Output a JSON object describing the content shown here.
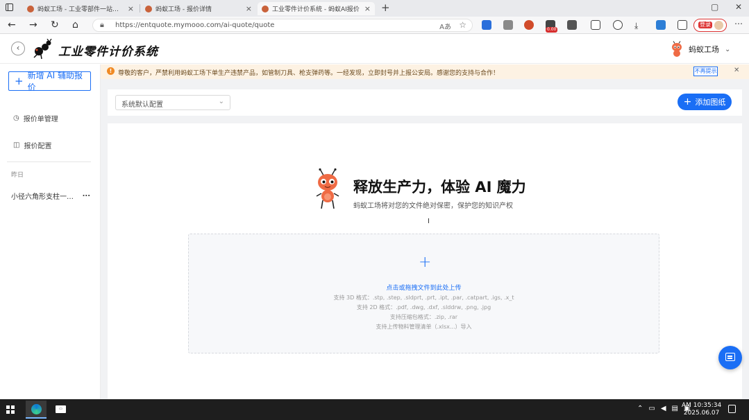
{
  "browser": {
    "tabs": [
      {
        "title": "蚂蚁工场 - 工业零部件一站式采购"
      },
      {
        "title": "蚂蚁工场 - 报价详情"
      },
      {
        "title": "工业零件计价系统 - 蚂蚁AI报价"
      }
    ],
    "url": "https://entquote.mymooo.com/ai-quote/quote",
    "reader_label": "Aあ",
    "ext_badge": "0.00",
    "user_label": "登录"
  },
  "app": {
    "brand": "工业零件计价系统",
    "account_name": "蚂蚁工场"
  },
  "sidebar": {
    "new_button": "新增 AI 辅助报价",
    "items": [
      {
        "label": "报价单管理",
        "icon": "clock-icon"
      },
      {
        "label": "报价配置",
        "icon": "layout-icon"
      }
    ],
    "section_label": "昨日",
    "history": [
      {
        "title": "小径六角形支柱一端外螺纹另一端内螺纹",
        "more": "..."
      }
    ]
  },
  "notice": {
    "text": "尊敬的客户，严禁利用蚂蚁工场下单生产违禁产品，如管制刀具、枪支弹药等。一经发现，立即封号并上报公安局。感谢您的支持与合作！",
    "no_more": "不再提示"
  },
  "main": {
    "config_select": "系统默认配置",
    "add_button": "添加图纸",
    "hero_title": "释放生产力，体验 AI 魔力",
    "hero_subtitle": "蚂蚁工场将对您的文件绝对保密，保护您的知识产权",
    "upload": {
      "action": "点击或拖拽文件到此处上传",
      "formats": [
        "支持 3D 格式：.stp, .step, .sldprt, .prt, .ipt, .par, .catpart, .igs, .x_t",
        "支持 2D 格式：.pdf, .dwg, .dxf, .slddrw, .png, .jpg",
        "支持压缩包格式：.zip, .rar",
        "支持上传物料管理清单（.xlsx...）导入"
      ]
    }
  },
  "taskbar": {
    "time": "AM 10:35:34",
    "date": "2025.06.07"
  }
}
